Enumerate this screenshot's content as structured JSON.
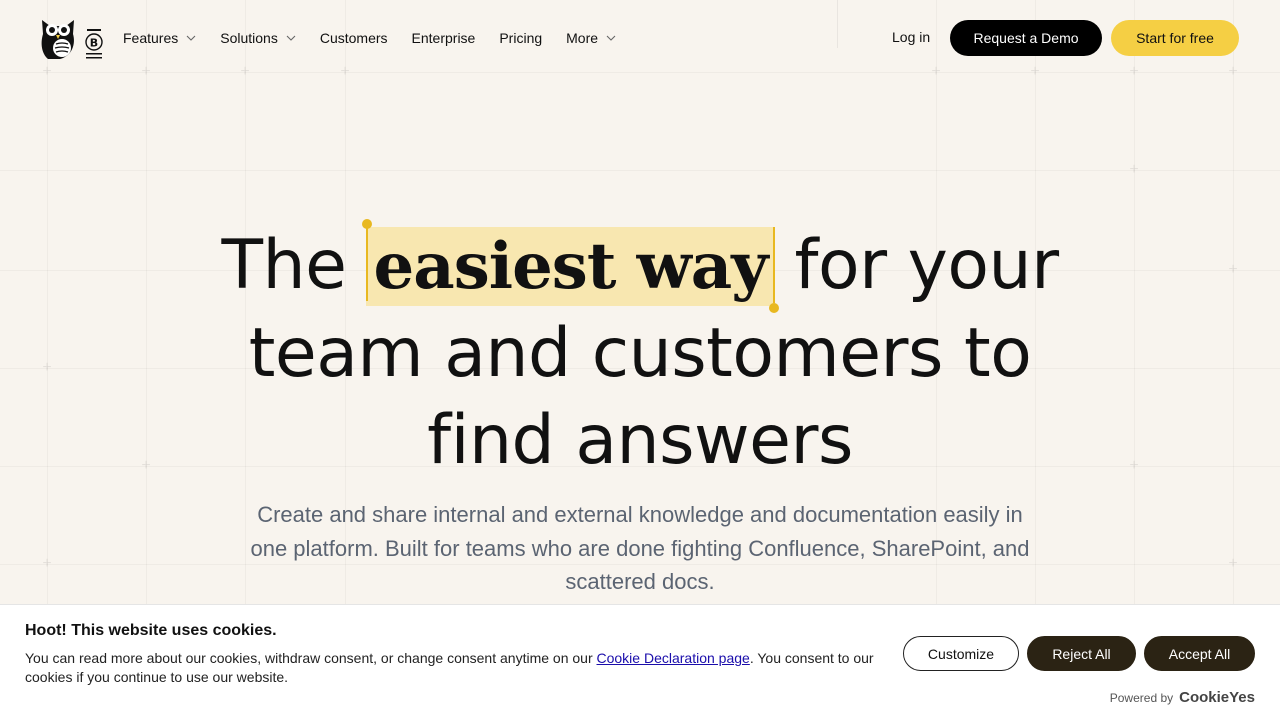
{
  "nav": {
    "items": [
      {
        "label": "Features",
        "dropdown": true
      },
      {
        "label": "Solutions",
        "dropdown": true
      },
      {
        "label": "Customers",
        "dropdown": false
      },
      {
        "label": "Enterprise",
        "dropdown": false
      },
      {
        "label": "Pricing",
        "dropdown": false
      },
      {
        "label": "More",
        "dropdown": true
      }
    ],
    "login": "Log in",
    "demo": "Request a Demo",
    "start": "Start for free"
  },
  "hero": {
    "line1_before": "The",
    "highlight": "easiest way",
    "line1_after": "for your",
    "line2": "team and customers to",
    "line3": "find answers",
    "subtitle": "Create and share internal and external knowledge and documentation easily in one platform. Built for teams who are done fighting Confluence, SharePoint, and scattered docs."
  },
  "cookie": {
    "title": "Hoot! This website uses cookies.",
    "text_before": "You can read more about our cookies, withdraw consent, or change consent anytime on our ",
    "link": "Cookie Declaration page",
    "text_after": ". You consent to our cookies if you continue to use our website.",
    "customize": "Customize",
    "reject": "Reject All",
    "accept": "Accept All",
    "powered_by": "Powered by",
    "brand": "CookieYes"
  },
  "colors": {
    "background": "#f8f4ee",
    "accent": "#f5cf44",
    "highlight": "#f8e7b0",
    "cookie_dark": "#2b2314"
  },
  "icons": {
    "logo": "owl-logo-icon",
    "bcorp": "b-corp-icon",
    "chevron": "chevron-down-icon"
  }
}
